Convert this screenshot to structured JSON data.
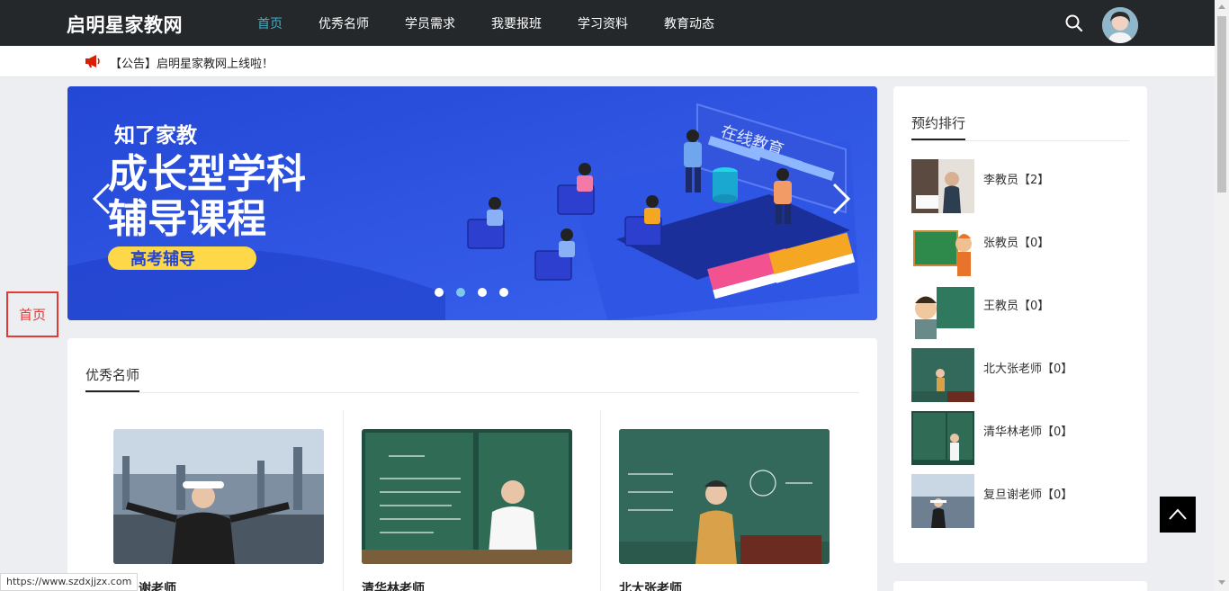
{
  "header": {
    "brand": "启明星家教网",
    "nav": [
      {
        "label": "首页",
        "active": true
      },
      {
        "label": "优秀名师",
        "active": false
      },
      {
        "label": "学员需求",
        "active": false
      },
      {
        "label": "我要报班",
        "active": false
      },
      {
        "label": "学习资料",
        "active": false
      },
      {
        "label": "教育动态",
        "active": false
      }
    ],
    "search_icon": "search-icon",
    "avatar_icon": "user-avatar"
  },
  "notice": {
    "icon": "megaphone-icon",
    "text": "【公告】启明星家教网上线啦！"
  },
  "banner": {
    "line1": "知了家教",
    "line2": "成长型学科",
    "line3": "辅导课程",
    "badge": "高考辅导",
    "screen": "在线教育",
    "dots": 4,
    "active_dot": 2
  },
  "float_home": "首页",
  "teachers": {
    "title": "优秀名师",
    "cards": [
      {
        "name": "复旦谢老师"
      },
      {
        "name": "清华林老师"
      },
      {
        "name": "北大张老师"
      }
    ]
  },
  "ranking": {
    "title": "预约排行",
    "items": [
      {
        "label": "李教员【2】"
      },
      {
        "label": "张教员【0】"
      },
      {
        "label": "王教员【0】"
      },
      {
        "label": "北大张老师【0】"
      },
      {
        "label": "清华林老师【0】"
      },
      {
        "label": "复旦谢老师【0】"
      }
    ]
  },
  "status_url": "https://www.szdxjjzx.com",
  "colors": {
    "nav_bg": "#24282b",
    "nav_active": "#3fb0c8",
    "banner_bg": "#2a54e0",
    "accent_red": "#e53935"
  }
}
